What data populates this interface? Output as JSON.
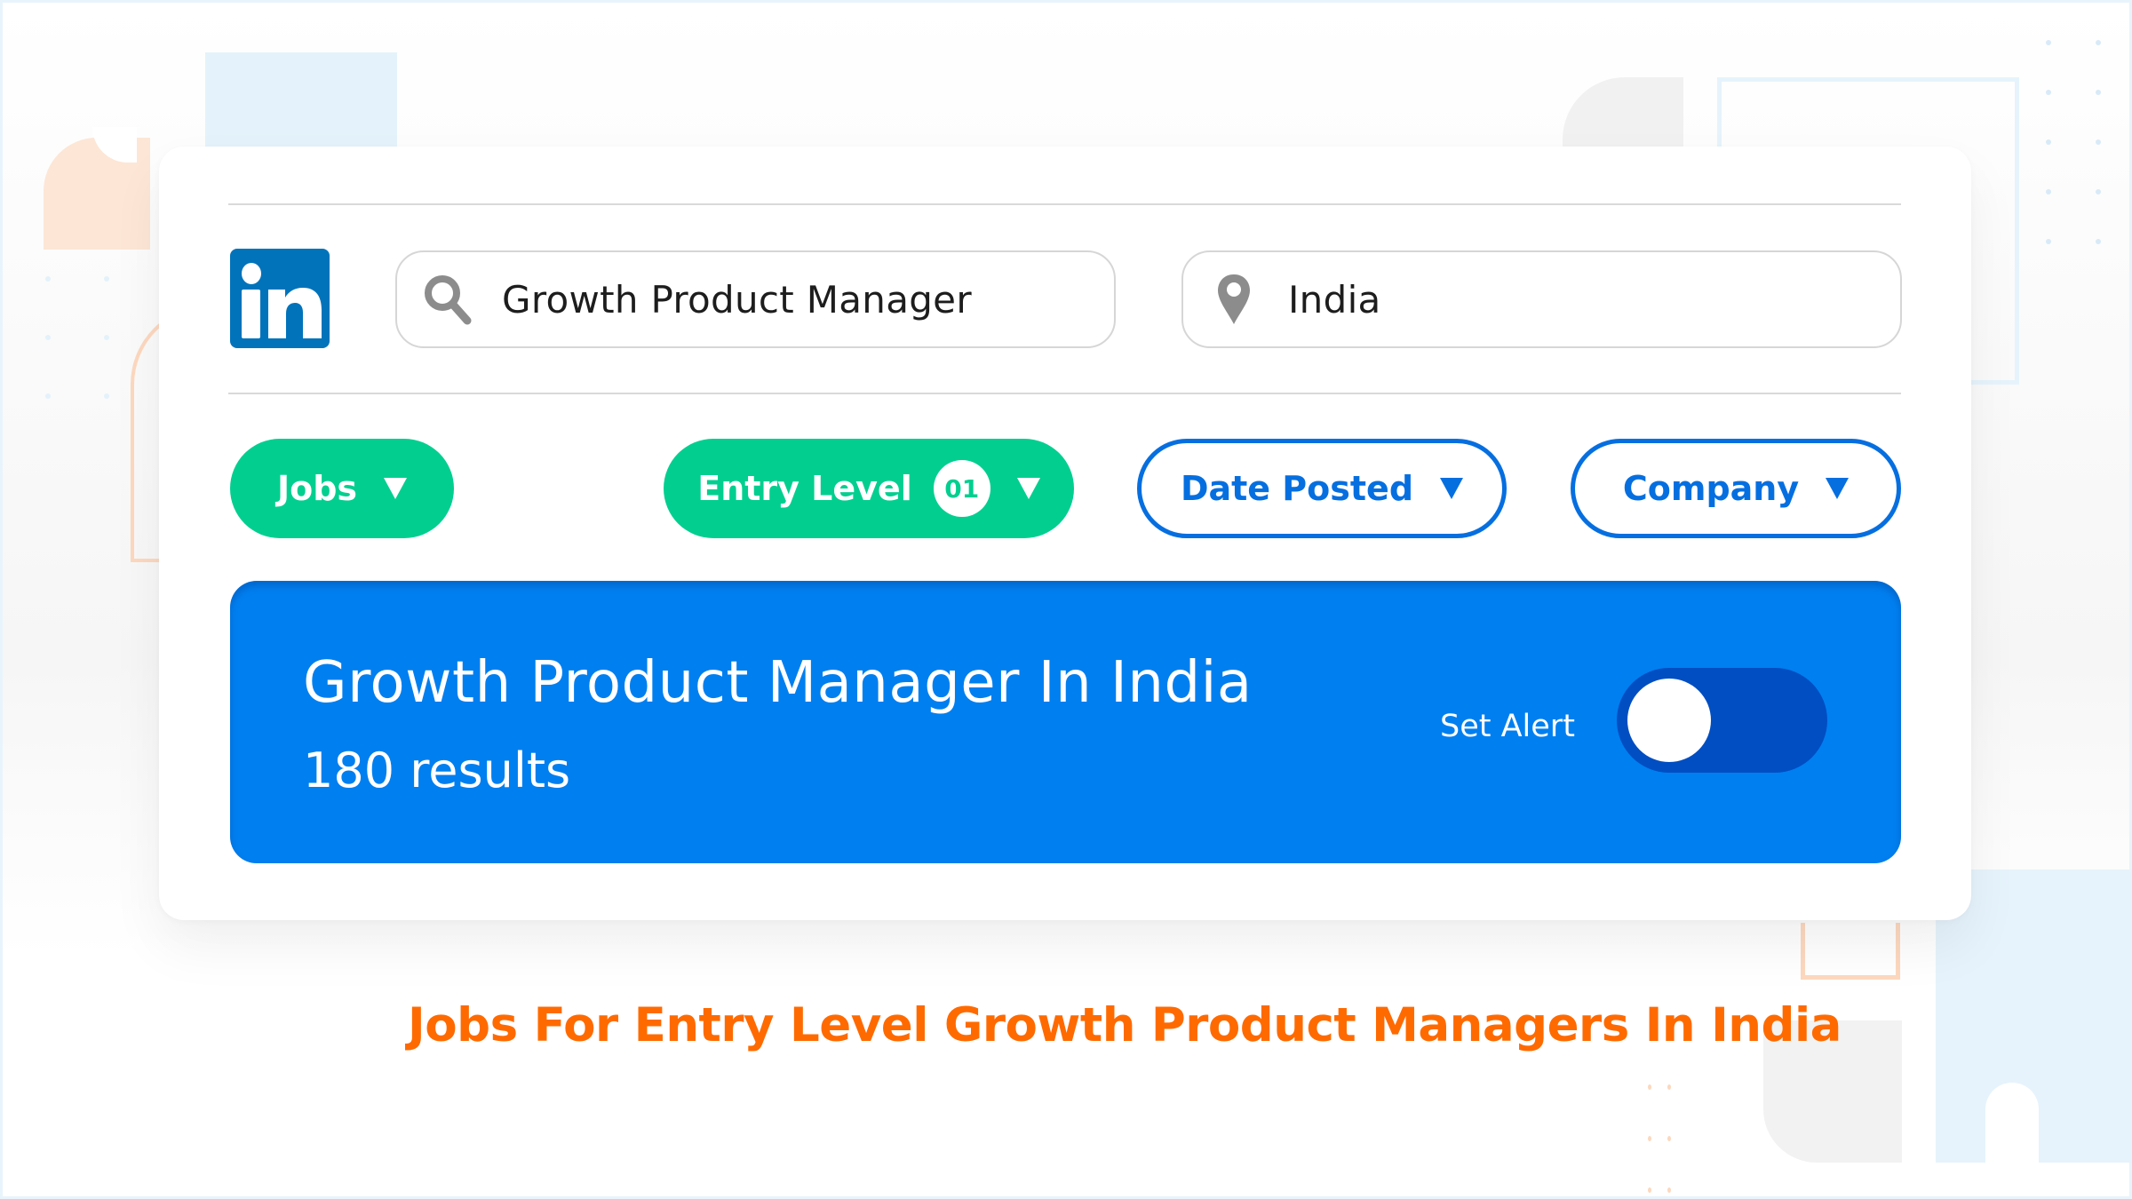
{
  "app": {
    "brand": "LinkedIn",
    "logo_icon": "linkedin-logo-icon",
    "brand_color": "#0073bb"
  },
  "search": {
    "query_value": "Growth Product Manager",
    "query_icon": "search-icon",
    "location_value": "India",
    "location_icon": "map-pin-icon"
  },
  "filters": [
    {
      "label": "Jobs",
      "style": "filled",
      "icon": "caret-down-icon"
    },
    {
      "label": "Entry Level",
      "style": "filled",
      "badge": "01",
      "icon": "caret-down-icon"
    },
    {
      "label": "Date Posted",
      "style": "outline",
      "icon": "caret-down-icon"
    },
    {
      "label": "Company",
      "style": "outline",
      "icon": "caret-down-icon"
    }
  ],
  "results_banner": {
    "title": "Growth Product Manager In India",
    "count_text": "180 results",
    "alert_label": "Set Alert",
    "alert_enabled": false
  },
  "tagline": "Jobs For Entry Level Growth Product Managers In India",
  "colors": {
    "green_chip": "#02cf8f",
    "blue_outline": "#066fe0",
    "banner_blue": "#007ff0",
    "toggle_track": "#004ec2",
    "tagline_orange": "#ff6a00"
  }
}
